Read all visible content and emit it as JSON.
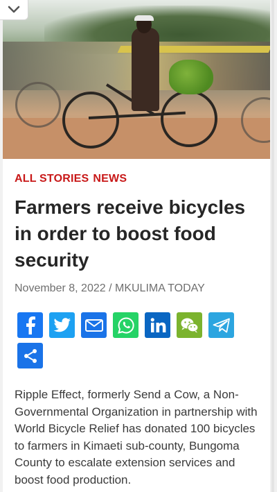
{
  "article": {
    "categories": [
      "ALL STORIES",
      "NEWS"
    ],
    "title": "Farmers receive bicycles in order to boost food security",
    "date": "November 8, 2022",
    "separator": "/",
    "author": "MKULIMA TODAY",
    "body": "Ripple Effect, formerly Send a Cow, a Non-Governmental Organization in partnership with World Bicycle Relief has donated 100 bicycles to farmers in Kimaeti sub-county, Bungoma County to escalate extension services and boost food production."
  },
  "share": {
    "buttons": [
      {
        "name": "facebook",
        "icon": "facebook-icon",
        "color": "#1877f2"
      },
      {
        "name": "twitter",
        "icon": "twitter-icon",
        "color": "#1da1f2"
      },
      {
        "name": "email",
        "icon": "email-icon",
        "color": "#1a73e8"
      },
      {
        "name": "whatsapp",
        "icon": "whatsapp-icon",
        "color": "#25d366"
      },
      {
        "name": "linkedin",
        "icon": "linkedin-icon",
        "color": "#0a66c2"
      },
      {
        "name": "wechat",
        "icon": "wechat-icon",
        "color": "#7bb32e"
      },
      {
        "name": "telegram",
        "icon": "telegram-icon",
        "color": "#2ca5e0"
      },
      {
        "name": "more",
        "icon": "share-icon",
        "color": "#1a73e8"
      }
    ]
  },
  "colors": {
    "category": "#c81818",
    "title": "#262626",
    "meta": "#6f6f6f",
    "body": "#3a3a3a"
  }
}
